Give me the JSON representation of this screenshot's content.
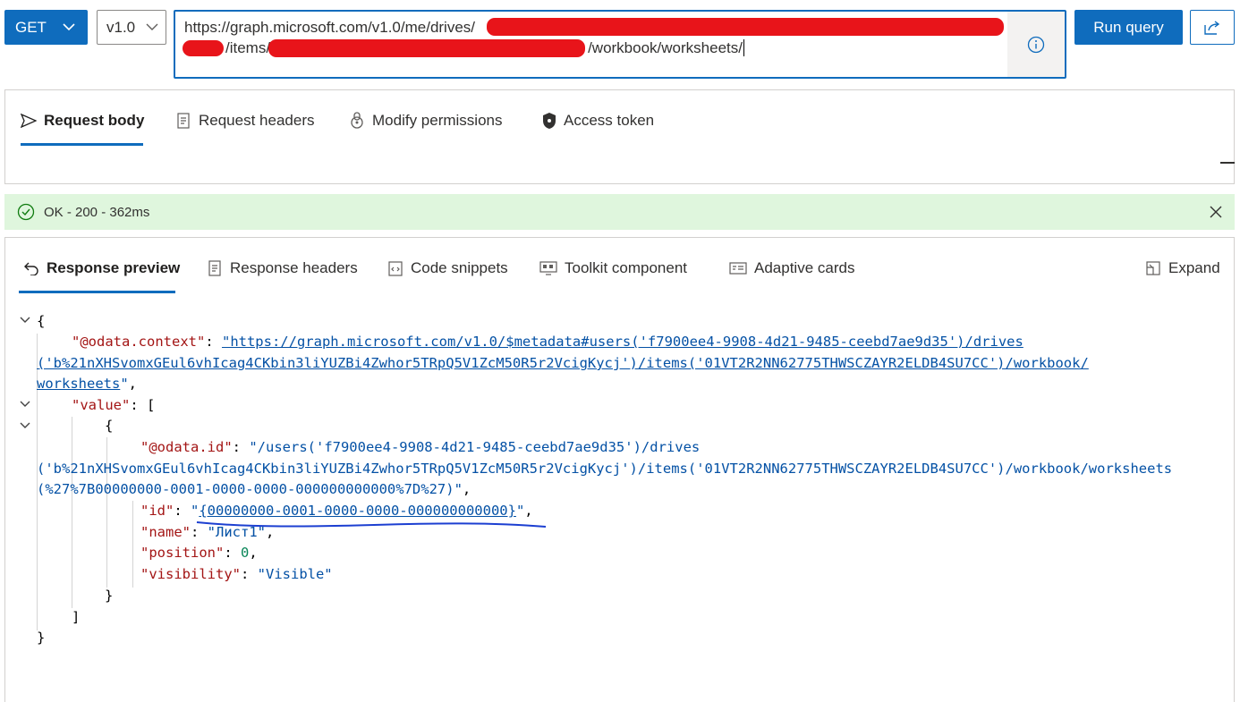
{
  "toolbar": {
    "method": "GET",
    "version": "v1.0",
    "url_line1": "https://graph.microsoft.com/v1.0/me/drives/",
    "url_line2_a": "/items/",
    "url_line2_b": "/workbook/worksheets/",
    "run_label": "Run query"
  },
  "request_tabs": [
    {
      "label": "Request body",
      "icon": "send-icon",
      "active": true
    },
    {
      "label": "Request headers",
      "icon": "document-icon"
    },
    {
      "label": "Modify permissions",
      "icon": "key-icon"
    },
    {
      "label": "Access token",
      "icon": "lock-icon"
    }
  ],
  "status": {
    "text": "OK - 200 - 362ms",
    "color": "#dff6dd"
  },
  "response_tabs": [
    {
      "label": "Response preview",
      "icon": "undo-icon",
      "active": true
    },
    {
      "label": "Response headers",
      "icon": "document-icon"
    },
    {
      "label": "Code snippets",
      "icon": "code-icon"
    },
    {
      "label": "Toolkit component",
      "icon": "toolkit-icon"
    },
    {
      "label": "Adaptive cards",
      "icon": "card-icon"
    }
  ],
  "expand_label": "Expand",
  "json": {
    "context_key": "\"@odata.context\"",
    "context_val_1": "\"https://graph.microsoft.com/v1.0/$metadata#users('f7900ee4-9908-4d21-9485-ceebd7ae9d35')/drives",
    "context_val_2": "('b%21nXHSvomxGEul6vhIcag4CKbin3liYUZBi4Zwhor5TRpQ5V1ZcM50R5r2VcigKycj')/items('01VT2R2NN62775THWSCZAYR2ELDB4SU7CC')/workbook/",
    "context_val_3": "worksheets",
    "value_key": "\"value\"",
    "odata_id_key": "\"@odata.id\"",
    "odata_id_val_1": "\"/users('f7900ee4-9908-4d21-9485-ceebd7ae9d35')/drives",
    "odata_id_val_2": "('b%21nXHSvomxGEul6vhIcag4CKbin3liYUZBi4Zwhor5TRpQ5V1ZcM50R5r2VcigKycj')/items('01VT2R2NN62775THWSCZAYR2ELDB4SU7CC')/workbook/worksheets",
    "odata_id_val_3": "(%27%7B00000000-0001-0000-0000-000000000000%7D%27)\"",
    "id_key": "\"id\"",
    "id_val": "{00000000-0001-0000-0000-000000000000}",
    "name_key": "\"name\"",
    "name_val": "\"Лист1\"",
    "position_key": "\"position\"",
    "position_val": "0",
    "visibility_key": "\"visibility\"",
    "visibility_val": "\"Visible\""
  },
  "colors": {
    "accent": "#0f6cbd",
    "redaction": "#e8141a",
    "success_bg": "#dff6dd"
  }
}
